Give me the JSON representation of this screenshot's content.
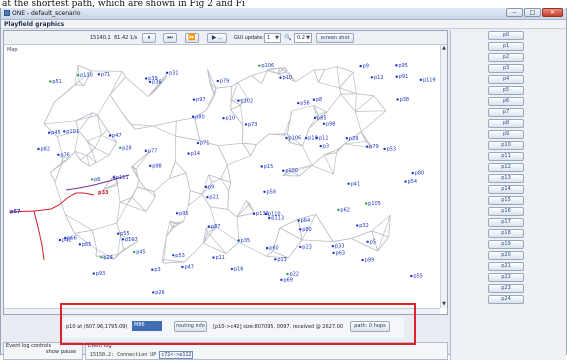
{
  "caption": "at the shortest path, which are shown in Fig 2 and Fi",
  "window": {
    "title": "ONE - default_scenario",
    "buttons": [
      "‒",
      "□",
      "✕"
    ]
  },
  "menubar": {
    "label": "Playfield graphics"
  },
  "toolbar": {
    "time": "15140.1",
    "speed": "81.42 1/s",
    "pause_icon": "⏸",
    "step_icon": "⏭",
    "ffw_icon": "⏩",
    "ffw2_label": "▶ ..",
    "gui_update_label": "GUI update:",
    "gui_update_value": "1",
    "zoom_icon": "🔍",
    "zoom_value": "0.2",
    "screenshot_label": "screen shot"
  },
  "map": {
    "label": "Map",
    "nodes_blue": [
      "p22",
      "p36",
      "p107",
      "p47",
      "p29",
      "p13",
      "p54",
      "p98",
      "p21",
      "p45",
      "p65",
      "p45",
      "p9",
      "p110",
      "p3",
      "p9",
      "p76",
      "p12",
      "p62",
      "p79",
      "p33",
      "p113",
      "p3",
      "p63",
      "p100",
      "p98",
      "p111",
      "p28",
      "p16",
      "p97",
      "p80",
      "p95",
      "p8",
      "p53",
      "p31",
      "p11",
      "p106",
      "p101",
      "p80",
      "p64",
      "p79",
      "p15",
      "p119",
      "p5",
      "p10",
      "p105",
      "p133",
      "p87",
      "p58",
      "p91",
      "p95",
      "p73",
      "p77",
      "p85",
      "p51",
      "p55",
      "p99",
      "p71",
      "p26",
      "p42",
      "p82",
      "p69",
      "p11",
      "p6",
      "p39",
      "p93",
      "p71",
      "p60",
      "p23",
      "p14",
      "p53",
      "p106",
      "p24",
      "p102",
      "p47",
      "p32",
      "p41",
      "p55",
      "p18",
      "p66",
      "p10",
      "p110",
      "p58",
      "p35",
      "p80",
      "p38"
    ],
    "nodes_red": [
      "p57",
      "p33"
    ]
  },
  "info_panel": {
    "location_text": "p10 at (607.96,1795.09)",
    "message_select": "M86",
    "routing_button": "routing info",
    "path_text": "[p10->c42] size:807095, 0097, received @ 2627.00",
    "hops_button": "path: 0 hops"
  },
  "eventlog_controls": {
    "title": "Event log controls",
    "show_label": "show",
    "pause_label": "pause"
  },
  "eventlog": {
    "title": "Event log",
    "entry_time": "15150.2:",
    "entry_text": "Connection UP",
    "entry_node": "c72<->e112"
  },
  "nodes": [
    "p0",
    "p1",
    "p2",
    "p3",
    "p4",
    "p5",
    "p6",
    "p7",
    "p8",
    "p9",
    "p10",
    "p11",
    "p12",
    "p13",
    "p14",
    "p15",
    "p16",
    "p17",
    "p18",
    "p19",
    "p20",
    "p21",
    "p22",
    "p23",
    "p24"
  ],
  "colors": {
    "road": "#b9bdc6",
    "node_blue": "#1b35c9",
    "node_red": "#c4121e",
    "route_red": "#d01f2b",
    "route_purple": "#7b2f8f",
    "highlight": "#e0212b"
  }
}
